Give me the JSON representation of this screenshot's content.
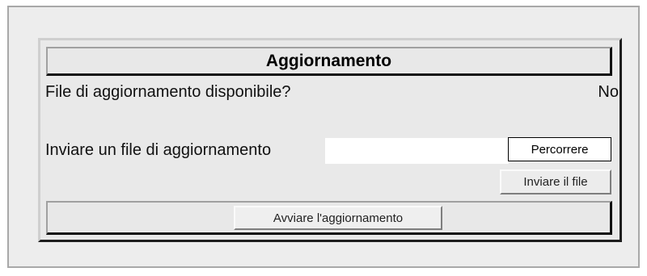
{
  "panel": {
    "title": "Aggiornamento"
  },
  "update_available": {
    "label": "File di aggiornamento disponibile?",
    "value": "No"
  },
  "send_file": {
    "label": "Inviare un file di aggiornamento",
    "input_value": "",
    "browse_label": "Percorrere",
    "send_label": "Inviare il file"
  },
  "footer": {
    "start_label": "Avviare l'aggiornamento"
  }
}
